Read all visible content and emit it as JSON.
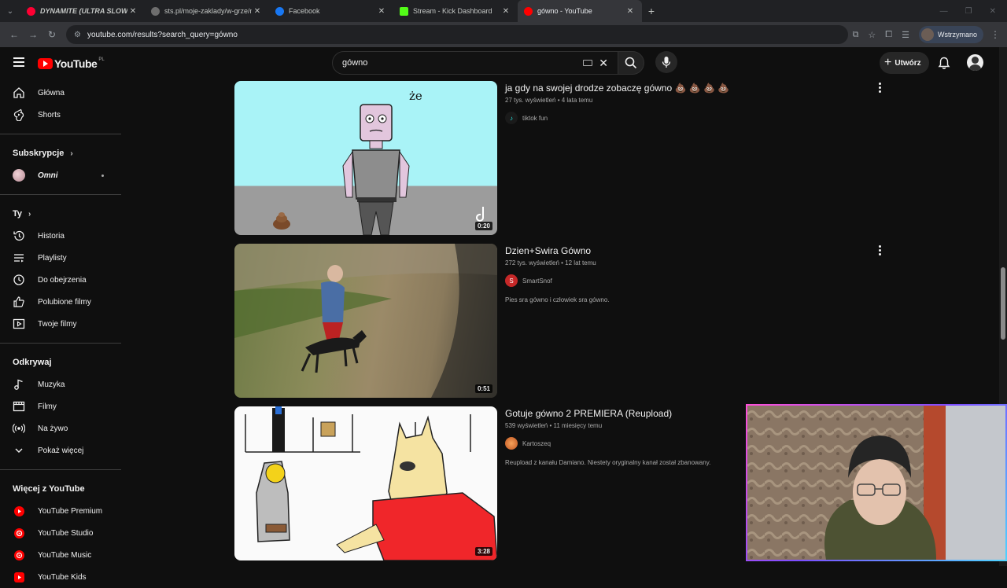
{
  "browser": {
    "tabs": [
      {
        "title": "DYNAMITE (ULTRA SLOWED",
        "favicon_color": "#ff0033",
        "active": false
      },
      {
        "title": "sts.pl/moje-zaklady/w-grze/mo",
        "favicon_color": "#6e6e6e",
        "active": false
      },
      {
        "title": "Facebook",
        "favicon_color": "#1877f2",
        "active": false
      },
      {
        "title": "Stream - Kick Dashboard",
        "favicon_color": "#53fc18",
        "active": false
      },
      {
        "title": "gówno - YouTube",
        "favicon_color": "#ff0000",
        "active": true
      }
    ],
    "url": "youtube.com/results?search_query=gówno",
    "profile_status": "Wstrzymano"
  },
  "header": {
    "logo_text": "YouTube",
    "country_code": "PL",
    "search_value": "gówno",
    "create_label": "Utwórz"
  },
  "sidebar": {
    "top": [
      {
        "label": "Główna",
        "icon": "home-icon"
      },
      {
        "label": "Shorts",
        "icon": "shorts-icon"
      }
    ],
    "subs_heading": "Subskrypcje",
    "subs": [
      {
        "label": "Omni"
      }
    ],
    "you_heading": "Ty",
    "you": [
      {
        "label": "Historia",
        "icon": "history-icon"
      },
      {
        "label": "Playlisty",
        "icon": "playlist-icon"
      },
      {
        "label": "Do obejrzenia",
        "icon": "clock-icon"
      },
      {
        "label": "Polubione filmy",
        "icon": "thumb-up-icon"
      },
      {
        "label": "Twoje filmy",
        "icon": "video-icon"
      }
    ],
    "explore_heading": "Odkrywaj",
    "explore": [
      {
        "label": "Muzyka",
        "icon": "music-icon"
      },
      {
        "label": "Filmy",
        "icon": "film-icon"
      },
      {
        "label": "Na żywo",
        "icon": "live-icon"
      },
      {
        "label": "Pokaż więcej",
        "icon": "chevron-down-icon"
      }
    ],
    "more_heading": "Więcej z YouTube",
    "more": [
      {
        "label": "YouTube Premium"
      },
      {
        "label": "YouTube Studio"
      },
      {
        "label": "YouTube Music"
      },
      {
        "label": "YouTube Kids"
      }
    ]
  },
  "results": [
    {
      "title": "ja gdy na swojej drodze zobaczę gówno 💩 💩 💩 💩",
      "meta": "27 tys. wyświetleń • 4 lata temu",
      "channel": "tiktok fun",
      "description": "",
      "duration": "0:20",
      "thumb_caption": "że"
    },
    {
      "title": "Dzien+Swira Gówno",
      "meta": "272 tys. wyświetleń • 12 lat temu",
      "channel": "SmartSnof",
      "channel_initial": "S",
      "description": "Pies sra gówno i człowiek sra gówno.",
      "duration": "0:51"
    },
    {
      "title": "Gotuje gówno 2 PREMIERA (Reupload)",
      "meta": "539 wyświetleń • 11 miesięcy temu",
      "channel": "Kartoszeq",
      "description": "Reupload z kanału Damiano. Niestety oryginalny kanał został zbanowany.",
      "duration": "3:28"
    }
  ]
}
